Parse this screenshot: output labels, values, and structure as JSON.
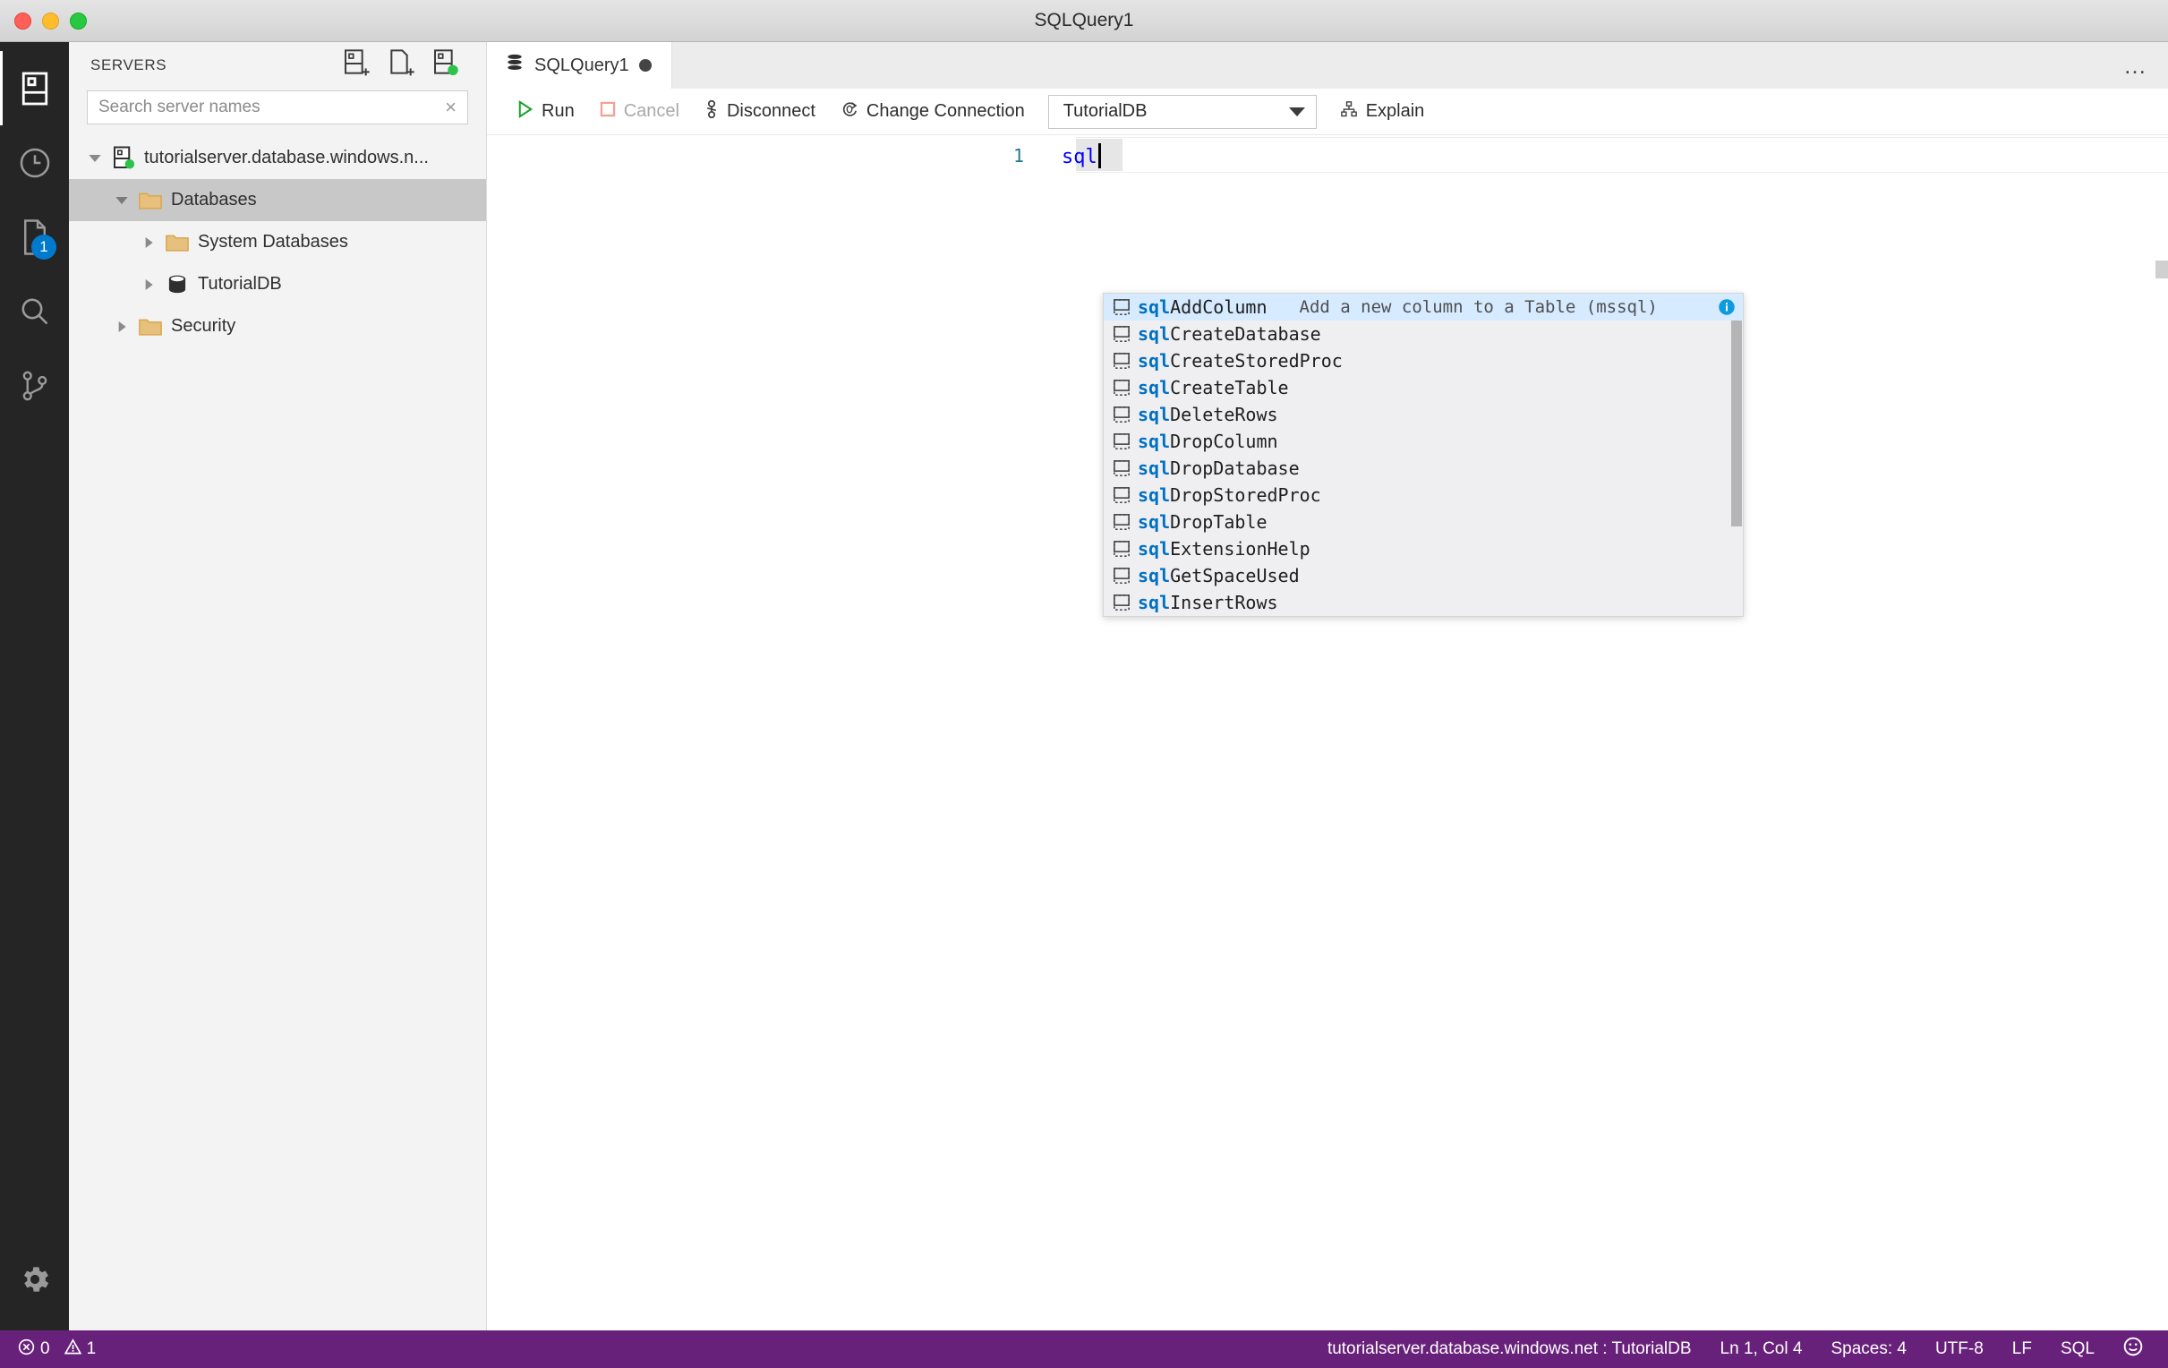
{
  "window": {
    "title": "SQLQuery1",
    "traffic": [
      "close",
      "minimize",
      "zoom"
    ]
  },
  "activitybar": {
    "items": [
      {
        "name": "servers",
        "icon": "servers-icon",
        "active": true
      },
      {
        "name": "history",
        "icon": "clock-icon",
        "active": false
      },
      {
        "name": "tasks",
        "icon": "file-icon",
        "active": false,
        "badge": "1"
      },
      {
        "name": "search",
        "icon": "search-icon",
        "active": false
      },
      {
        "name": "source-control",
        "icon": "source-control-icon",
        "active": false
      }
    ],
    "bottom": {
      "name": "manage",
      "icon": "gear-icon"
    }
  },
  "sidebar": {
    "title": "SERVERS",
    "actions": [
      {
        "name": "new-connection",
        "icon": "new-connection-icon",
        "tooltip": "New Connection"
      },
      {
        "name": "new-server-group",
        "icon": "new-server-group-icon",
        "tooltip": "New Server Group"
      },
      {
        "name": "refresh",
        "icon": "active-connections-icon",
        "tooltip": "Active Connections"
      }
    ],
    "search": {
      "placeholder": "Search server names",
      "value": "",
      "clear_label": "×"
    },
    "tree": [
      {
        "label": "tutorialserver.database.windows.n...",
        "indent": 0,
        "twisty": "down",
        "icon": "server-icon",
        "selected": false
      },
      {
        "label": "Databases",
        "indent": 1,
        "twisty": "down",
        "icon": "folder-icon",
        "selected": true
      },
      {
        "label": "System Databases",
        "indent": 2,
        "twisty": "right",
        "icon": "folder-icon",
        "selected": false
      },
      {
        "label": "TutorialDB",
        "indent": 2,
        "twisty": "right",
        "icon": "database-icon",
        "selected": false
      },
      {
        "label": "Security",
        "indent": 1,
        "twisty": "right",
        "icon": "folder-icon",
        "selected": false
      }
    ]
  },
  "editor": {
    "tab": {
      "label": "SQLQuery1",
      "icon": "database-icon",
      "dirty": true
    },
    "more_actions_label": "…",
    "toolbar": {
      "run_label": "Run",
      "cancel_label": "Cancel",
      "disconnect_label": "Disconnect",
      "change_connection_label": "Change Connection",
      "database_selected": "TutorialDB",
      "explain_label": "Explain"
    },
    "code": {
      "line_number": "1",
      "text": "sql"
    }
  },
  "suggest": {
    "items": [
      {
        "label_prefix": "sql",
        "label_rest": "AddColumn",
        "detail": "Add a new column to a Table (mssql)",
        "focused": true,
        "has_info": true
      },
      {
        "label_prefix": "sql",
        "label_rest": "CreateDatabase",
        "detail": "",
        "focused": false,
        "has_info": false
      },
      {
        "label_prefix": "sql",
        "label_rest": "CreateStoredProc",
        "detail": "",
        "focused": false,
        "has_info": false
      },
      {
        "label_prefix": "sql",
        "label_rest": "CreateTable",
        "detail": "",
        "focused": false,
        "has_info": false
      },
      {
        "label_prefix": "sql",
        "label_rest": "DeleteRows",
        "detail": "",
        "focused": false,
        "has_info": false
      },
      {
        "label_prefix": "sql",
        "label_rest": "DropColumn",
        "detail": "",
        "focused": false,
        "has_info": false
      },
      {
        "label_prefix": "sql",
        "label_rest": "DropDatabase",
        "detail": "",
        "focused": false,
        "has_info": false
      },
      {
        "label_prefix": "sql",
        "label_rest": "DropStoredProc",
        "detail": "",
        "focused": false,
        "has_info": false
      },
      {
        "label_prefix": "sql",
        "label_rest": "DropTable",
        "detail": "",
        "focused": false,
        "has_info": false
      },
      {
        "label_prefix": "sql",
        "label_rest": "ExtensionHelp",
        "detail": "",
        "focused": false,
        "has_info": false
      },
      {
        "label_prefix": "sql",
        "label_rest": "GetSpaceUsed",
        "detail": "",
        "focused": false,
        "has_info": false
      },
      {
        "label_prefix": "sql",
        "label_rest": "InsertRows",
        "detail": "",
        "focused": false,
        "has_info": false
      }
    ]
  },
  "statusbar": {
    "errors": "0",
    "warnings": "1",
    "connection": "tutorialserver.database.windows.net : TutorialDB",
    "position": "Ln 1, Col 4",
    "spaces": "Spaces: 4",
    "encoding": "UTF-8",
    "eol": "LF",
    "language": "SQL",
    "feedback_icon": "smiley-icon",
    "background": "#68217a"
  }
}
